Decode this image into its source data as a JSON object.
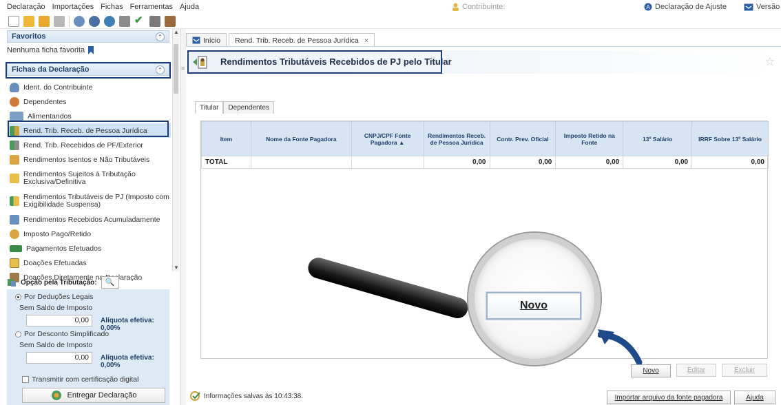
{
  "menu": {
    "items": [
      "Declaração",
      "Importações",
      "Fichas",
      "Ferramentas",
      "Ajuda"
    ],
    "contribuinte": "Contribuinte:",
    "declaracao_ajuste": "Declaração de Ajuste",
    "versao": "Versão"
  },
  "toolbar": {
    "icons": [
      "new-file-icon",
      "open-folder-icon",
      "folder-icon",
      "trash-icon",
      "import-icon",
      "gear-icon",
      "globe-icon",
      "print-icon",
      "check-icon",
      "calculator-icon",
      "book-icon"
    ]
  },
  "left": {
    "favoritos_title": "Favoritos",
    "favoritos_empty": "Nenhuma ficha favorita",
    "fichas_title": "Fichas da Declaração",
    "fichas": [
      {
        "label": "Ident. do Contribuinte",
        "icon": "person-icon",
        "color": "#6a8fbf"
      },
      {
        "label": "Dependentes",
        "icon": "dependents-icon",
        "color": "#d07a3a"
      },
      {
        "label": "Alimentandos",
        "icon": "alimentandos-icon",
        "color": "#7fa0c6"
      },
      {
        "label": "Rend. Trib. Receb. de Pessoa Jurídica",
        "icon": "pj-income-icon",
        "color": "#4a9a5a"
      },
      {
        "label": "Rend. Trib. Recebidos de PF/Exterior",
        "icon": "pf-income-icon",
        "color": "#4a9a5a"
      },
      {
        "label": "Rendimentos Isentos e Não Tributáveis",
        "icon": "exempt-income-icon",
        "color": "#d9a441"
      },
      {
        "label": "Rendimentos Sujeitos à Tributação Exclusiva/Definitiva",
        "icon": "exclusive-income-icon",
        "color": "#d9a441"
      },
      {
        "label": "Rendimentos Tributáveis de PJ (Imposto com Exigibilidade Suspensa)",
        "icon": "suspended-income-icon",
        "color": "#c9a23c"
      },
      {
        "label": "Rendimentos Recebidos Acumuladamente",
        "icon": "accumulated-income-icon",
        "color": "#6a8fbf"
      },
      {
        "label": "Imposto Pago/Retido",
        "icon": "tax-paid-icon",
        "color": "#d9a441"
      },
      {
        "label": "Pagamentos Efetuados",
        "icon": "payments-icon",
        "color": "#3a8a4a"
      },
      {
        "label": "Doações Efetuadas",
        "icon": "donations-icon",
        "color": "#d9a441"
      },
      {
        "label": "Doações Diretamente na Declaração",
        "icon": "direct-donations-icon",
        "color": "#9c7a4a"
      }
    ],
    "opcao_label": "Opção pela Tributação:",
    "deducoes_label": "Por Deduções Legais",
    "deducoes_saldo_label": "Sem Saldo de Imposto",
    "deducoes_value": "0,00",
    "deducoes_aliquota": "Alíquota efetiva: 0,00%",
    "simplificado_label": "Por Desconto Simplificado",
    "simplificado_saldo_label": "Sem Saldo de Imposto",
    "simplificado_value": "0,00",
    "simplificado_aliquota": "Alíquota efetiva: 0,00%",
    "transmitir_label": "Transmitir com certificação digital",
    "entregar_label": "Entregar Declaração"
  },
  "tabs": [
    {
      "label": "Início"
    },
    {
      "label": "Rend. Trib. Receb. de Pessoa Jurídica",
      "close": "×"
    }
  ],
  "main": {
    "title": "Rendimentos Tributáveis Recebidos de PJ pelo Titular",
    "subtabs": [
      "Titular",
      "Dependentes"
    ],
    "columns": [
      "Item",
      "Nome da Fonte Pagadora",
      "CNPJ/CPF Fonte Pagadora ▲",
      "Rendimentos Receb. de Pessoa Jurídica",
      "Contr. Prev. Oficial",
      "Imposto Retido na Fonte",
      "13º Salário",
      "IRRF Sobre 13º Salário"
    ],
    "total_row": [
      "TOTAL",
      "",
      "",
      "0,00",
      "0,00",
      "0,00",
      "0,00",
      "0,00"
    ],
    "magnifier_label": "Novo",
    "buttons": {
      "novo": "Novo",
      "editar": "Editar",
      "excluir": "Excluir"
    },
    "import_button": "Importar arquivo da fonte pagadora",
    "help_button": "Ajuda",
    "status": "Informações salvas às 10:43:38."
  },
  "colors": {
    "accent_dark": "#1b3c7a",
    "header_bg": "#d7e4f2",
    "panel_bg": "#ddeaf6"
  }
}
